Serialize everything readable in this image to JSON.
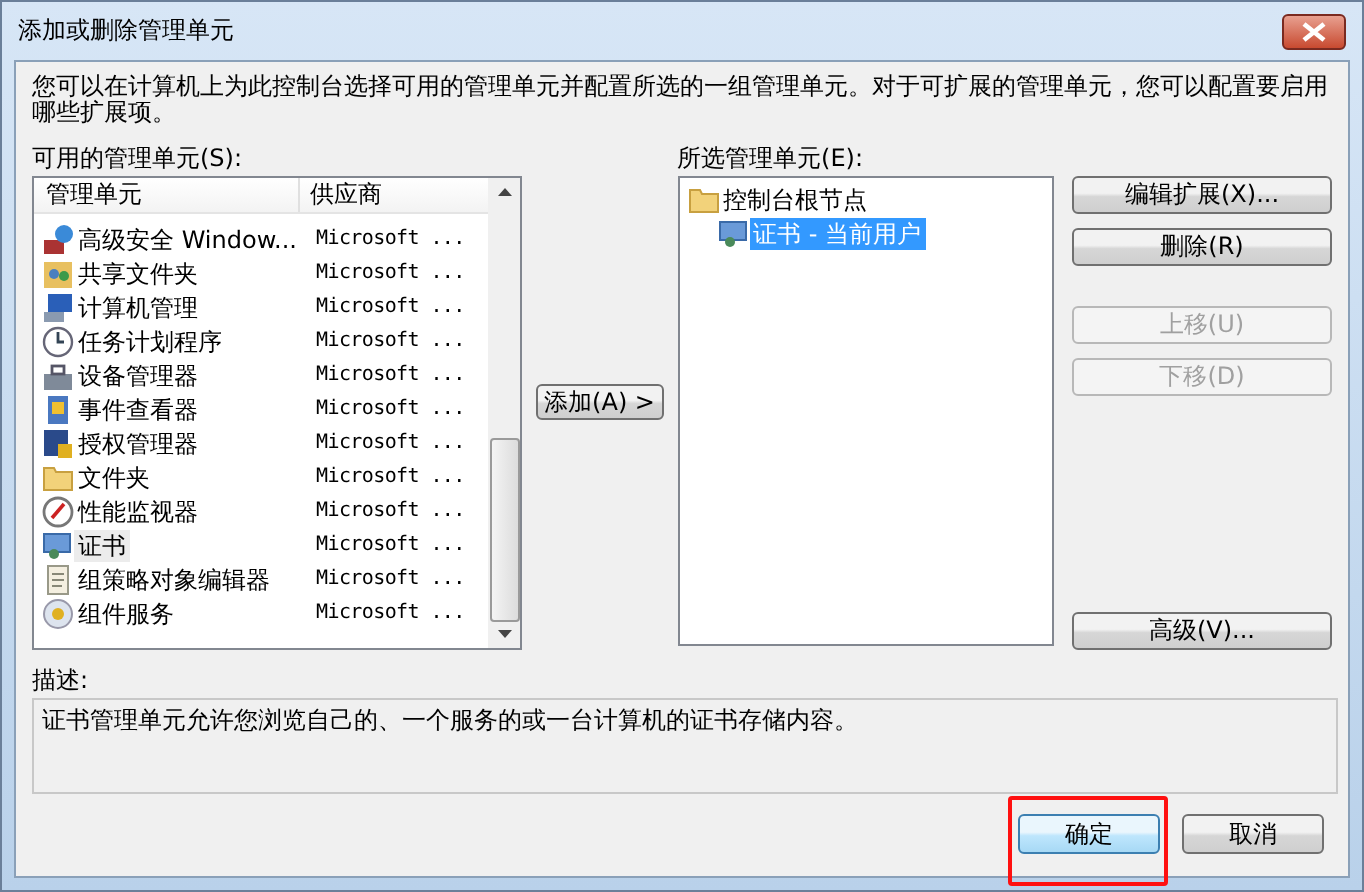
{
  "window": {
    "title": "添加或删除管理单元"
  },
  "intro": "您可以在计算机上为此控制台选择可用的管理单元并配置所选的一组管理单元。对于可扩展的管理单元，您可以配置要启用哪些扩展项。",
  "available": {
    "label": "可用的管理单元(S):",
    "columns": [
      "管理单元",
      "供应商"
    ],
    "rows": [
      {
        "name": "高级安全 Window...",
        "vendor": "Microsoft ...",
        "selected": false
      },
      {
        "name": "共享文件夹",
        "vendor": "Microsoft ...",
        "selected": false
      },
      {
        "name": "计算机管理",
        "vendor": "Microsoft ...",
        "selected": false
      },
      {
        "name": "任务计划程序",
        "vendor": "Microsoft ...",
        "selected": false
      },
      {
        "name": "设备管理器",
        "vendor": "Microsoft ...",
        "selected": false
      },
      {
        "name": "事件查看器",
        "vendor": "Microsoft ...",
        "selected": false
      },
      {
        "name": "授权管理器",
        "vendor": "Microsoft ...",
        "selected": false
      },
      {
        "name": "文件夹",
        "vendor": "Microsoft ...",
        "selected": false
      },
      {
        "name": "性能监视器",
        "vendor": "Microsoft ...",
        "selected": false
      },
      {
        "name": "证书",
        "vendor": "Microsoft ...",
        "selected": true
      },
      {
        "name": "组策略对象编辑器",
        "vendor": "Microsoft ...",
        "selected": false
      },
      {
        "name": "组件服务",
        "vendor": "Microsoft ...",
        "selected": false
      }
    ]
  },
  "add_button": "添加(A) >",
  "selected_snapins": {
    "label": "所选管理单元(E):",
    "tree": [
      {
        "label": "控制台根节点",
        "selected": false,
        "children": [
          {
            "label": "证书 - 当前用户",
            "selected": true
          }
        ]
      }
    ]
  },
  "side_buttons": [
    {
      "label": "编辑扩展(X)...",
      "disabled": false
    },
    {
      "label": "删除(R)",
      "disabled": false
    },
    {
      "label": "上移(U)",
      "disabled": true
    },
    {
      "label": "下移(D)",
      "disabled": true
    },
    {
      "label": "高级(V)...",
      "disabled": false
    }
  ],
  "description": {
    "label": "描述:",
    "text": "证书管理单元允许您浏览自己的、一个服务的或一台计算机的证书存储内容。"
  },
  "footer_buttons": [
    {
      "label": "确定",
      "highlighted": true
    },
    {
      "label": "取消",
      "highlighted": false
    }
  ]
}
